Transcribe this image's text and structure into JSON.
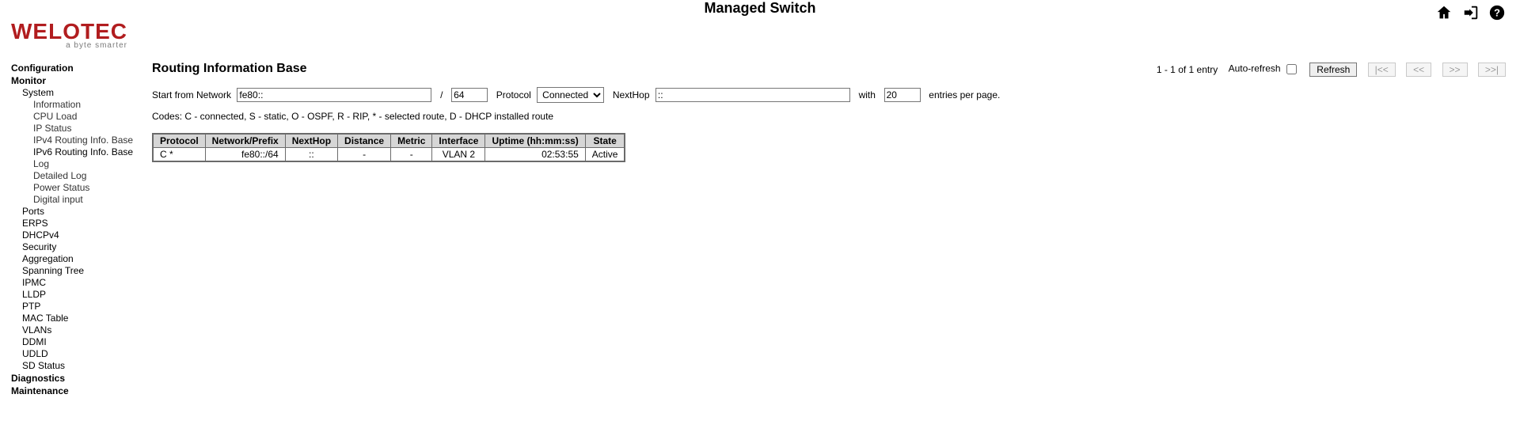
{
  "brand": {
    "name": "WELOTEC",
    "tagline": "a byte smarter"
  },
  "header": {
    "title": "Managed Switch"
  },
  "nav": {
    "configuration": "Configuration",
    "monitor": "Monitor",
    "system": "System",
    "system_children": {
      "information": "Information",
      "cpu_load": "CPU Load",
      "ip_status": "IP Status",
      "ipv4_rib": "IPv4 Routing Info. Base",
      "ipv6_rib": "IPv6 Routing Info. Base",
      "log": "Log",
      "detailed_log": "Detailed Log",
      "power_status": "Power Status",
      "digital_input": "Digital input"
    },
    "ports": "Ports",
    "erps": "ERPS",
    "dhcpv4": "DHCPv4",
    "security": "Security",
    "aggregation": "Aggregation",
    "spanning_tree": "Spanning Tree",
    "ipmc": "IPMC",
    "lldp": "LLDP",
    "ptp": "PTP",
    "mac_table": "MAC Table",
    "vlans": "VLANs",
    "ddmi": "DDMI",
    "udld": "UDLD",
    "sd_status": "SD Status",
    "diagnostics": "Diagnostics",
    "maintenance": "Maintenance"
  },
  "page": {
    "heading": "Routing Information Base",
    "counter": "1 - 1 of 1 entry",
    "auto_refresh_label": "Auto-refresh",
    "refresh_label": "Refresh",
    "first_label": "|<<",
    "prev_label": "<<",
    "next_label": ">>",
    "last_label": ">>|",
    "filters": {
      "start_label": "Start from Network",
      "network_value": "fe80::",
      "slash": "/",
      "prefix_value": "64",
      "protocol_label": "Protocol",
      "protocol_selected": "Connected",
      "protocol_options": [
        "Connected"
      ],
      "nexthop_label": "NextHop",
      "nexthop_value": "::",
      "with_label": "with",
      "entries_value": "20",
      "entries_suffix": "entries per page."
    },
    "codes": "Codes: C - connected, S - static, O - OSPF, R - RIP, * - selected route, D - DHCP installed route",
    "table": {
      "headers": {
        "protocol": "Protocol",
        "network": "Network/Prefix",
        "nexthop": "NextHop",
        "distance": "Distance",
        "metric": "Metric",
        "interface": "Interface",
        "uptime": "Uptime (hh:mm:ss)",
        "state": "State"
      },
      "rows": [
        {
          "protocol": "C *",
          "network": "fe80::/64",
          "nexthop": "::",
          "distance": "-",
          "metric": "-",
          "interface": "VLAN 2",
          "uptime": "02:53:55",
          "state": "Active"
        }
      ]
    }
  }
}
